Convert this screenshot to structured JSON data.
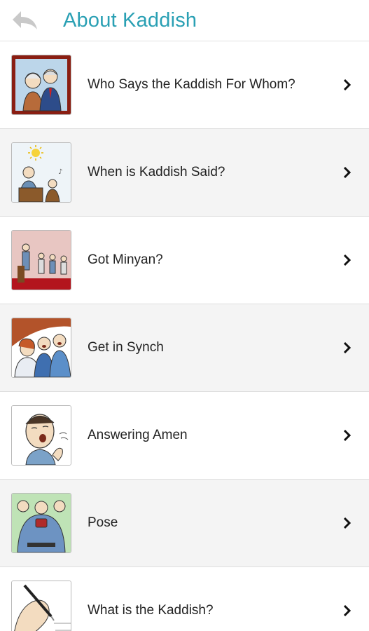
{
  "header": {
    "title": "About Kaddish",
    "back_icon": "back-arrow-icon"
  },
  "items": [
    {
      "label": "Who Says the Kaddish For Whom?",
      "image": "elderly-couple-illustration"
    },
    {
      "label": "When is Kaddish Said?",
      "image": "man-at-lectern-sunrise-illustration"
    },
    {
      "label": "Got Minyan?",
      "image": "men-praying-in-synagogue-illustration"
    },
    {
      "label": "Get in Synch",
      "image": "people-singing-together-illustration"
    },
    {
      "label": "Answering Amen",
      "image": "man-answering-amen-illustration"
    },
    {
      "label": "Pose",
      "image": "man-bowing-pose-illustration"
    },
    {
      "label": "What is the Kaddish?",
      "image": "hand-writing-illustration"
    }
  ],
  "colors": {
    "title": "#2aa0b4",
    "alt_row": "#f4f4f4",
    "text": "#222222"
  }
}
